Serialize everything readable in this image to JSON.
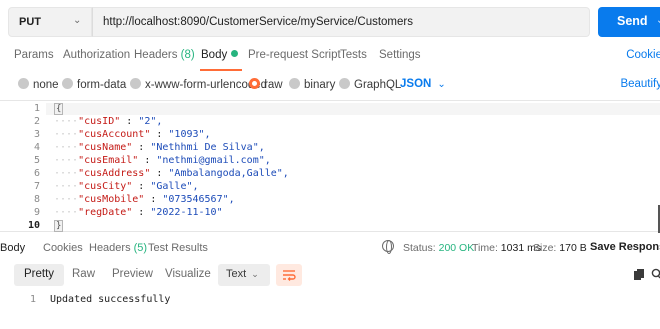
{
  "request": {
    "method": "PUT",
    "url": "http://localhost:8090/CustomerService/myService/Customers",
    "send_label": "Send"
  },
  "tabs": [
    {
      "label": "Params"
    },
    {
      "label": "Authorization"
    },
    {
      "label": "Headers",
      "count": "(8)"
    },
    {
      "label": "Body"
    },
    {
      "label": "Pre-request Script"
    },
    {
      "label": "Tests"
    },
    {
      "label": "Settings"
    }
  ],
  "cookies_label": "Cookie",
  "body_types": [
    {
      "label": "none",
      "selected": false
    },
    {
      "label": "form-data",
      "selected": false
    },
    {
      "label": "x-www-form-urlencoded",
      "selected": false
    },
    {
      "label": "raw",
      "selected": true
    },
    {
      "label": "binary",
      "selected": false
    },
    {
      "label": "GraphQL",
      "selected": false
    }
  ],
  "format_label": "JSON",
  "beautify_label": "Beautify",
  "editor": {
    "open_brace": "{",
    "close_brace": "}",
    "lines": [
      {
        "key": "\"cusID\"",
        "value": "\"2\","
      },
      {
        "key": "\"cusAccount\"",
        "value": "\"1093\","
      },
      {
        "key": "\"cusName\"",
        "value": "\"Nethhmi De Silva\","
      },
      {
        "key": "\"cusEmail\"",
        "value": "\"nethmi@gmail.com\","
      },
      {
        "key": "\"cusAddress\"",
        "value": "\"Ambalangoda,Galle\","
      },
      {
        "key": "\"cusCity\"",
        "value": "\"Galle\","
      },
      {
        "key": "\"cusMobile\"",
        "value": "\"073546567\","
      },
      {
        "key": "\"regDate\"",
        "value": "\"2022-11-10\""
      }
    ],
    "line_numbers": [
      "1",
      "2",
      "3",
      "4",
      "5",
      "6",
      "7",
      "8",
      "9",
      "10"
    ]
  },
  "response": {
    "tabs": [
      {
        "label": "Body"
      },
      {
        "label": "Cookies"
      },
      {
        "label": "Headers",
        "count": "(5)"
      },
      {
        "label": "Test Results"
      }
    ],
    "status_label": "Status:",
    "status_value": "200 OK",
    "time_label": "Time:",
    "time_value": "1031 ms",
    "size_label": "Size:",
    "size_value": "170 B",
    "save_label": "Save Response",
    "views": [
      "Pretty",
      "Raw",
      "Preview",
      "Visualize"
    ],
    "text_format": "Text",
    "line_number": "1",
    "body_text": "Updated successfully"
  },
  "colors": {
    "accent": "#ff6c37",
    "primary": "#097bed",
    "success": "#26b47f"
  }
}
